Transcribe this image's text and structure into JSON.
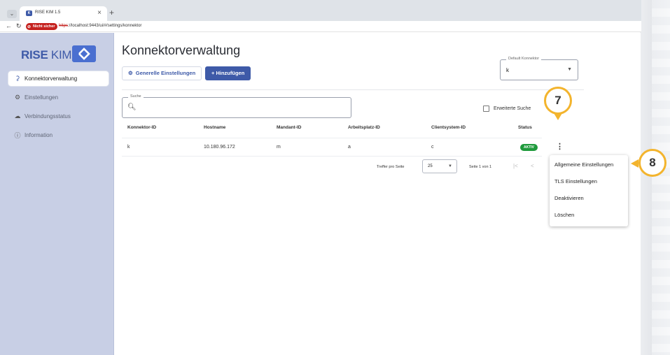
{
  "browser": {
    "tab_title": "RISE KIM 1.5",
    "favicon_text": "K",
    "not_secure_label": "Nicht sicher",
    "url_scheme": "https",
    "url_rest": "://localhost:9443/ui/#/settings/konnektor"
  },
  "sidebar": {
    "logo_bold": "RISE",
    "logo_light": " KIM",
    "items": [
      {
        "label": "Konnektorverwaltung",
        "icon": "connector-icon",
        "glyph": "⚳",
        "active": true
      },
      {
        "label": "Einstellungen",
        "icon": "people-settings-icon",
        "glyph": "⚙",
        "active": false
      },
      {
        "label": "Verbindungsstatus",
        "icon": "cloud-icon",
        "glyph": "☁",
        "active": false
      },
      {
        "label": "Information",
        "icon": "info-icon",
        "glyph": "ⓘ",
        "active": false
      }
    ]
  },
  "main": {
    "title": "Konnektorverwaltung",
    "btn_general": "Generelle Einstellungen",
    "btn_add": "+ Hinzufügen",
    "default_connector": {
      "legend": "Default Konnektor",
      "value": "k"
    },
    "search": {
      "legend": "Suche",
      "value": ""
    },
    "advanced_search": "Erweiterte Suche",
    "columns": [
      "Konnektor-ID",
      "Hostname",
      "Mandant-ID",
      "Arbeitsplatz-ID",
      "Clientsystem-ID",
      "Status"
    ],
    "rows": [
      {
        "konnektor_id": "k",
        "hostname": "10.180.96.172",
        "mandant_id": "m",
        "arbeitsplatz_id": "a",
        "clientsystem_id": "c",
        "status": "AKTIV"
      }
    ],
    "pager": {
      "label": "Treffer pro Seite",
      "per_page": "25",
      "info": "Seite 1 von 1"
    }
  },
  "context_menu": {
    "items": [
      "Allgemeine Einstellungen",
      "TLS Einstellungen",
      "Deaktivieren",
      "Löschen"
    ]
  },
  "callouts": {
    "step_a": "7",
    "step_b": "8"
  },
  "colors": {
    "brand": "#3e5aa8",
    "status_active": "#1f9a3c",
    "callout": "#f3b42d",
    "not_secure": "#c5221f"
  }
}
